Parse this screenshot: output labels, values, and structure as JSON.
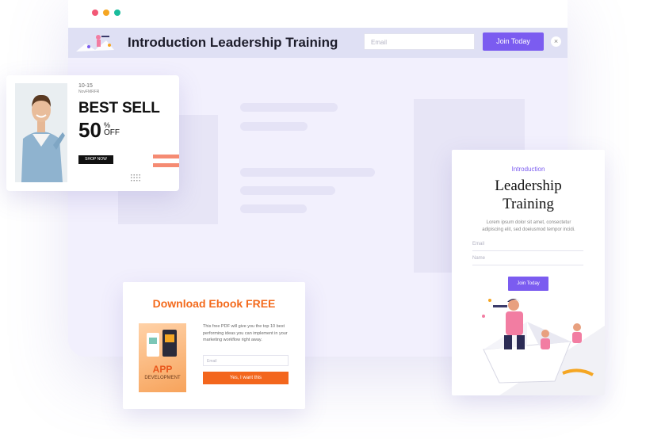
{
  "window": {
    "controls": [
      "close",
      "minimize",
      "maximize"
    ]
  },
  "banner": {
    "title": "Introduction Leadership Training",
    "email_placeholder": "Email",
    "button_label": "Join Today",
    "close_label": "×"
  },
  "sell_card": {
    "date": "10-15",
    "subtitle": "NovFMRFR",
    "title": "BEST SELL",
    "discount_number": "50",
    "percent_sign": "%",
    "off_label": "OFF",
    "button_label": "SHOP NOW"
  },
  "lead_card": {
    "eyebrow": "Introduction",
    "title": "Leadership Training",
    "lorem": "Lorem ipsum dolor sit amet, consectetur adipiscing elit, sed doeiusmod tempor incidi.",
    "email_placeholder": "Email",
    "name_placeholder": "Name",
    "button_label": "Join Today"
  },
  "ebook_card": {
    "title": "Download Ebook FREE",
    "cover_title": "APP",
    "cover_subtitle": "DEVELOPMENT",
    "description": "This free PDF will give you the top 10 best performing ideas you can implement in your marketing workflow right away.",
    "email_placeholder": "Email",
    "button_label": "Yes, I want this"
  },
  "colors": {
    "accent_purple": "#7b5cf0",
    "accent_orange": "#f36a1c",
    "stripe_coral": "#f58b73",
    "window_bg": "#f3f1ff"
  }
}
